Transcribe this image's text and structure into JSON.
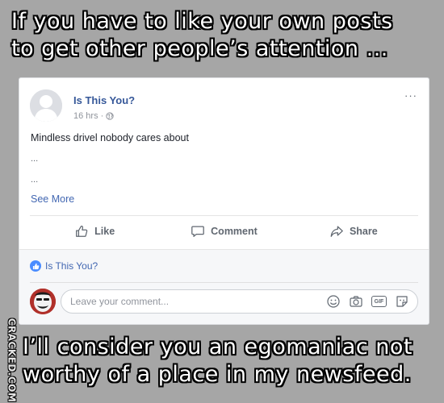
{
  "captions": {
    "top_line1": "If you have to like your own posts",
    "top_line2": "to get other people’s attention ...",
    "bottom_line1": "I’ll consider you an egomaniac not",
    "bottom_line2": "worthy of a place in my newsfeed."
  },
  "watermark": "CRACKED.COM",
  "post": {
    "author": "Is This You?",
    "time": "16 hrs",
    "meta_separator": "·",
    "privacy_icon": "globe-icon",
    "more_label": "···",
    "text": "Mindless drivel nobody cares about",
    "ellipsis_1": "...",
    "ellipsis_2": "...",
    "see_more": "See More"
  },
  "actions": {
    "like": "Like",
    "comment": "Comment",
    "share": "Share"
  },
  "reactions": {
    "liker_name": "Is This You?",
    "icon": "thumbs-up-icon"
  },
  "comment_box": {
    "placeholder": "Leave your comment...",
    "tools": [
      "emoji-icon",
      "camera-icon",
      "gif-icon",
      "sticker-icon"
    ],
    "gif_label": "GIF"
  },
  "colors": {
    "background": "#a6a6a6",
    "link_blue": "#365899",
    "action_gray": "#606770",
    "like_badge": "#4a8cff"
  }
}
